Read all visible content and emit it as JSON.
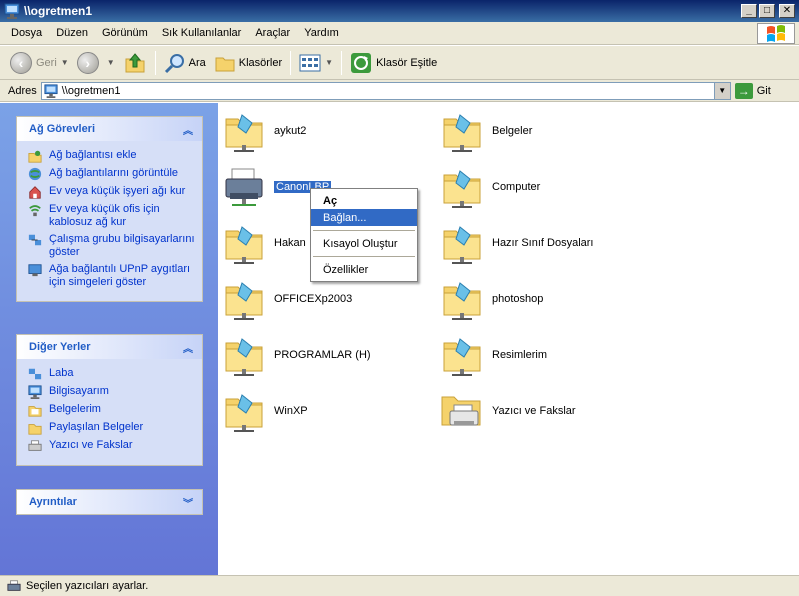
{
  "window": {
    "title": "\\\\ogretmen1",
    "minimize_label": "_",
    "maximize_label": "□",
    "close_label": "✕"
  },
  "menu": [
    "Dosya",
    "Düzen",
    "Görünüm",
    "Sık Kullanılanlar",
    "Araçlar",
    "Yardım"
  ],
  "toolbar": {
    "back_label": "Geri",
    "search_label": "Ara",
    "folders_label": "Klasörler",
    "sync_label": "Klasör Eşitle"
  },
  "address": {
    "label": "Adres",
    "value": "\\\\ogretmen1",
    "go_label": "Git"
  },
  "sidebar": {
    "network_tasks": {
      "title": "Ağ Görevleri",
      "items": [
        "Ağ bağlantısı ekle",
        "Ağ bağlantılarını görüntüle",
        "Ev veya küçük işyeri ağı kur",
        "Ev veya küçük ofis için kablosuz ağ kur",
        "Çalışma grubu bilgisayarlarını göster",
        "Ağa bağlantılı UPnP aygıtları için simgeleri göster"
      ]
    },
    "other_places": {
      "title": "Diğer Yerler",
      "items": [
        "Laba",
        "Bilgisayarım",
        "Belgelerim",
        "Paylaşılan Belgeler",
        "Yazıcı ve Fakslar"
      ]
    },
    "details": {
      "title": "Ayrıntılar"
    }
  },
  "items": [
    {
      "label": "aykut2",
      "type": "folder"
    },
    {
      "label": "Belgeler",
      "type": "folder"
    },
    {
      "label": "CanonLBP",
      "type": "printer",
      "selected": true
    },
    {
      "label": "Computer",
      "type": "folder"
    },
    {
      "label": "Hakan",
      "type": "folder"
    },
    {
      "label": "Hazır Sınıf Dosyaları",
      "type": "folder"
    },
    {
      "label": "OFFICEXp2003",
      "type": "folder"
    },
    {
      "label": "photoshop",
      "type": "folder"
    },
    {
      "label": "PROGRAMLAR (H)",
      "type": "folder"
    },
    {
      "label": "Resimlerim",
      "type": "folder"
    },
    {
      "label": "WinXP",
      "type": "folder"
    },
    {
      "label": "Yazıcı ve Fakslar",
      "type": "printers-folder"
    }
  ],
  "context_menu": {
    "open": "Aç",
    "connect": "Bağlan...",
    "create_shortcut": "Kısayol Oluştur",
    "properties": "Özellikler"
  },
  "status": {
    "text": "Seçilen yazıcıları ayarlar."
  },
  "colors": {
    "title_bar": "#0a246a",
    "highlight": "#316ac5",
    "sidebar_bg": "#7ba2e7",
    "panel_body": "#d6dff7",
    "link": "#0033cc",
    "panel_title": "#215dc6"
  }
}
